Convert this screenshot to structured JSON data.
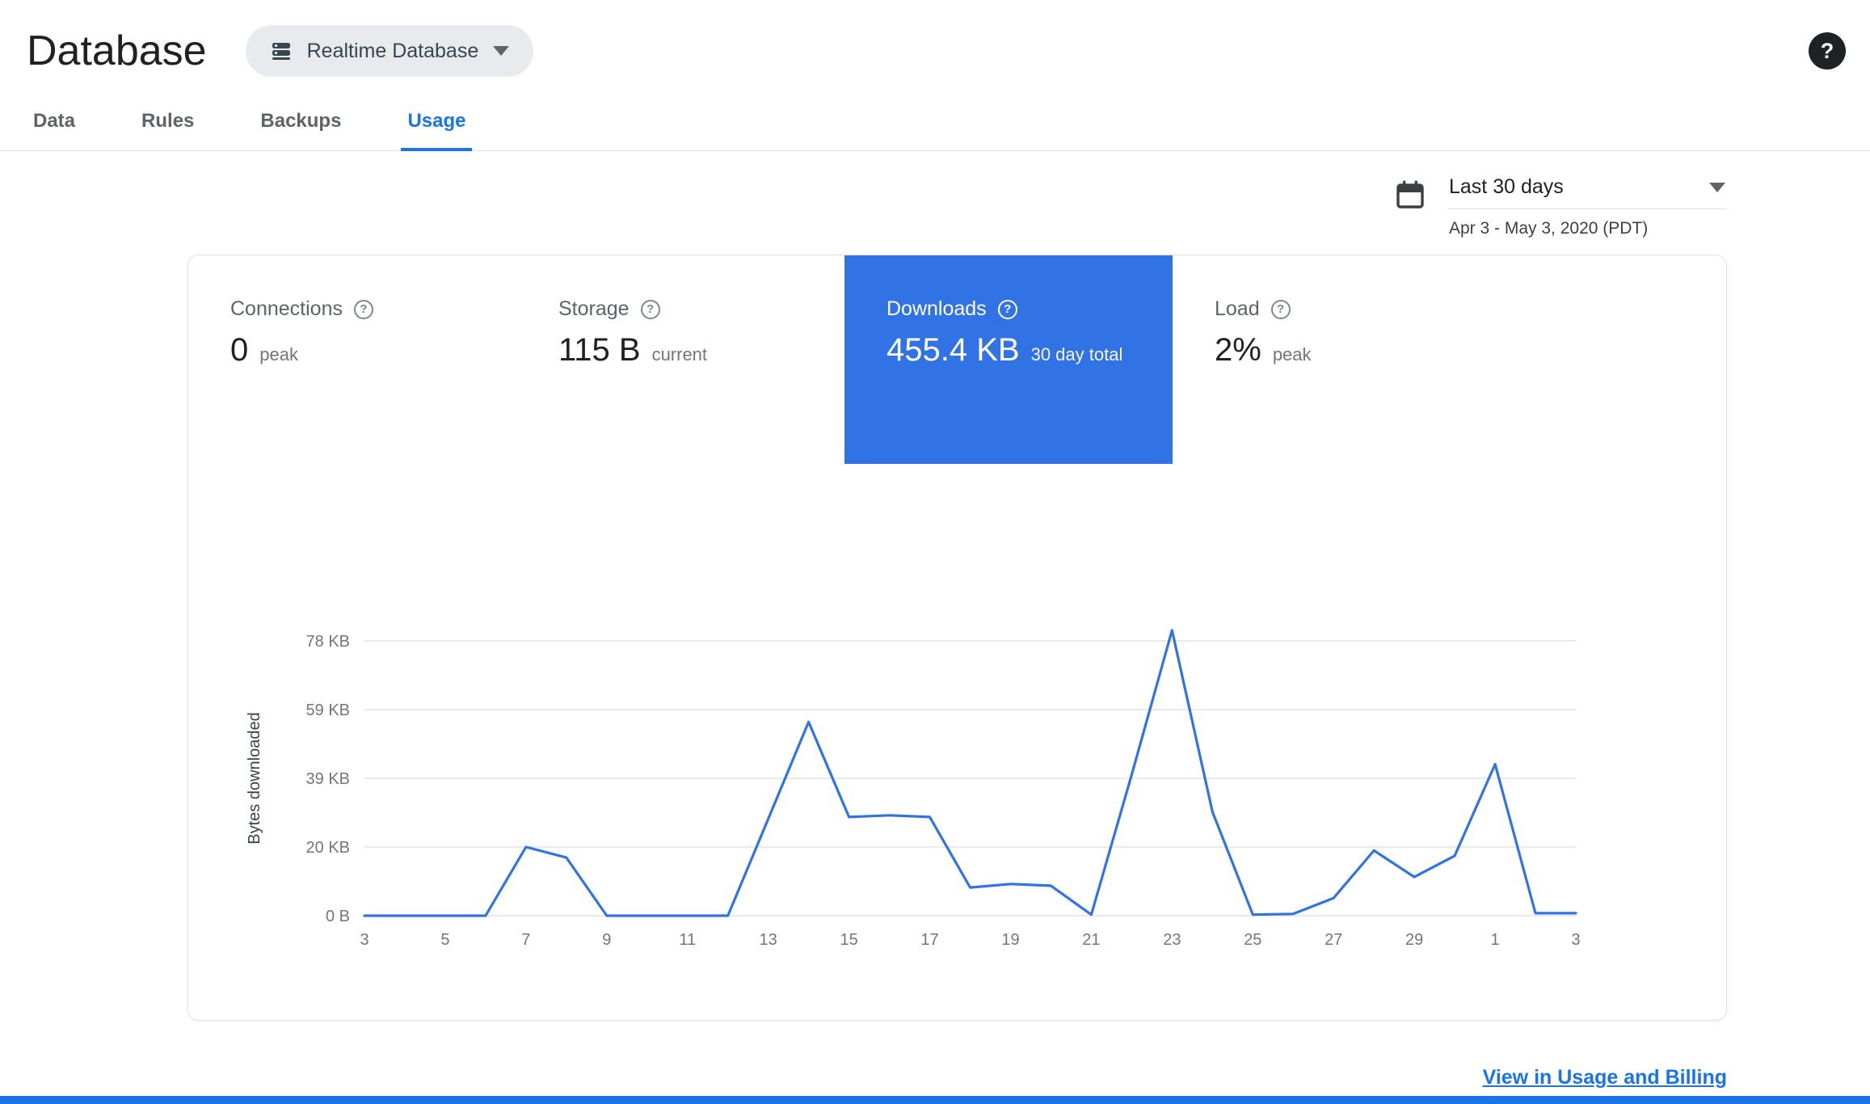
{
  "header": {
    "title": "Database",
    "db_selector_label": "Realtime Database"
  },
  "icons": {
    "help_glyph": "?"
  },
  "tabs": [
    {
      "label": "Data",
      "active": false
    },
    {
      "label": "Rules",
      "active": false
    },
    {
      "label": "Backups",
      "active": false
    },
    {
      "label": "Usage",
      "active": true
    }
  ],
  "date_range": {
    "label": "Last 30 days",
    "subtitle": "Apr 3 - May 3, 2020 (PDT)"
  },
  "metrics": [
    {
      "label": "Connections",
      "value": "0",
      "suffix": "peak",
      "selected": false
    },
    {
      "label": "Storage",
      "value": "115 B",
      "suffix": "current",
      "selected": false
    },
    {
      "label": "Downloads",
      "value": "455.4 KB",
      "suffix": "30 day total",
      "selected": true
    },
    {
      "label": "Load",
      "value": "2%",
      "suffix": "peak",
      "selected": false
    }
  ],
  "footer_link": {
    "label": "View in Usage and Billing"
  },
  "colors": {
    "accent": "#1a73e8",
    "selected_metric_bg": "#3173e4",
    "footer_bar": "#1a73e8"
  },
  "chart_data": {
    "type": "line",
    "ylabel": "Bytes downloaded",
    "unit": "KB",
    "x_days": [
      3,
      4,
      5,
      6,
      7,
      8,
      9,
      10,
      11,
      12,
      13,
      14,
      15,
      16,
      17,
      18,
      19,
      20,
      21,
      22,
      23,
      24,
      25,
      26,
      27,
      28,
      29,
      30,
      1,
      2,
      3
    ],
    "values_kb": [
      0,
      0,
      0,
      0,
      19.5,
      16.5,
      0,
      0,
      0,
      0,
      27.5,
      55,
      28,
      28.5,
      28,
      8,
      9,
      8.5,
      0.3,
      40,
      81,
      29.5,
      0.3,
      0.5,
      5,
      18.5,
      11,
      17,
      43,
      0.7,
      0.7
    ],
    "yticks": [
      {
        "label": "0 B",
        "kb": 0
      },
      {
        "label": "20 KB",
        "kb": 19.5
      },
      {
        "label": "39 KB",
        "kb": 39
      },
      {
        "label": "59 KB",
        "kb": 58.5
      },
      {
        "label": "78 KB",
        "kb": 78
      }
    ],
    "xtick_labels": [
      "3",
      "5",
      "7",
      "9",
      "11",
      "13",
      "15",
      "17",
      "19",
      "21",
      "23",
      "25",
      "27",
      "29",
      "1",
      "3"
    ],
    "ymax_kb": 78,
    "line_color": "#3173e4",
    "grid": "horizontal",
    "legend": "none"
  }
}
